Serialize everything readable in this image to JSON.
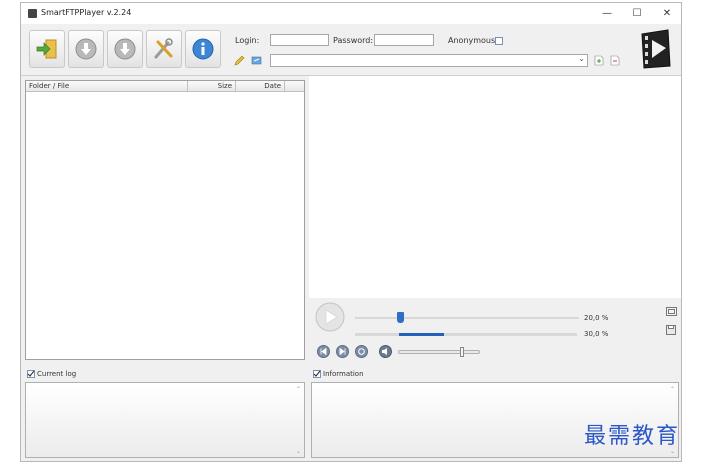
{
  "window": {
    "title": "SmartFTPPlayer v.2.24"
  },
  "window_controls": {
    "minimize": "—",
    "maximize": "☐",
    "close": "✕"
  },
  "toolbar": {
    "buttons": [
      {
        "name": "connect",
        "icon": "connect-arrow-icon"
      },
      {
        "name": "download",
        "icon": "download-icon"
      },
      {
        "name": "download-all",
        "icon": "download-icon"
      },
      {
        "name": "settings",
        "icon": "tools-icon"
      },
      {
        "name": "about",
        "icon": "info-icon"
      }
    ],
    "login_label": "Login:",
    "login_value": "",
    "password_label": "Password:",
    "password_value": "",
    "anonymous_label": "Anonymous",
    "url_value": ""
  },
  "file_list": {
    "columns": [
      "Folder / File",
      "Size",
      "Date"
    ]
  },
  "player": {
    "position_percent": "20,0 %",
    "buffer_percent": "30,0 %",
    "position_fraction": 0.2,
    "buffer_fraction": 0.3,
    "volume_fraction": 0.77
  },
  "current_log": {
    "label": "Current log"
  },
  "information": {
    "label": "Information"
  },
  "watermark": {
    "text": "最需教育"
  }
}
